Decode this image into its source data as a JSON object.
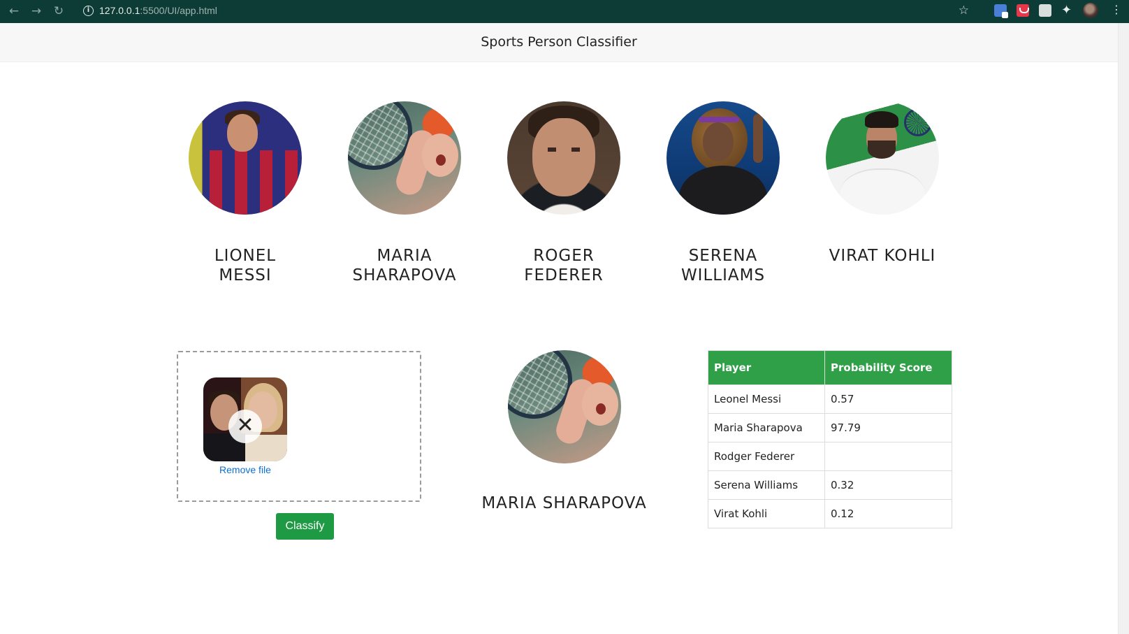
{
  "browser": {
    "url_host": "127.0.0.1",
    "url_rest": ":5500/UI/app.html"
  },
  "header": {
    "title": "Sports Person Classifier"
  },
  "players": [
    {
      "name_line1": "LIONEL",
      "name_line2": "MESSI"
    },
    {
      "name_line1": "MARIA",
      "name_line2": "SHARAPOVA"
    },
    {
      "name_line1": "ROGER",
      "name_line2": "FEDERER"
    },
    {
      "name_line1": "SERENA",
      "name_line2": "WILLIAMS"
    },
    {
      "name_line1": "VIRAT KOHLI",
      "name_line2": ""
    }
  ],
  "upload": {
    "remove_label": "Remove file",
    "classify_label": "Classify"
  },
  "result": {
    "name": "MARIA SHARAPOVA"
  },
  "table": {
    "headers": [
      "Player",
      "Probability Score"
    ],
    "rows": [
      {
        "player": "Leonel Messi",
        "score": "0.57"
      },
      {
        "player": "Maria Sharapova",
        "score": "97.79"
      },
      {
        "player": "Rodger Federer",
        "score": ""
      },
      {
        "player": "Serena Williams",
        "score": "0.32"
      },
      {
        "player": "Virat Kohli",
        "score": "0.12"
      }
    ]
  },
  "colors": {
    "chrome": "#0d3b35",
    "accent_green": "#1d9a43",
    "table_header": "#2f9f48",
    "link_blue": "#0b6fd6"
  },
  "icons": [
    "back-arrow-icon",
    "forward-arrow-icon",
    "reload-icon",
    "info-icon",
    "star-icon",
    "translate-extension-icon",
    "pocket-extension-icon",
    "page-extension-icon",
    "puzzle-icon",
    "profile-avatar",
    "kebab-menu-icon",
    "close-icon"
  ]
}
